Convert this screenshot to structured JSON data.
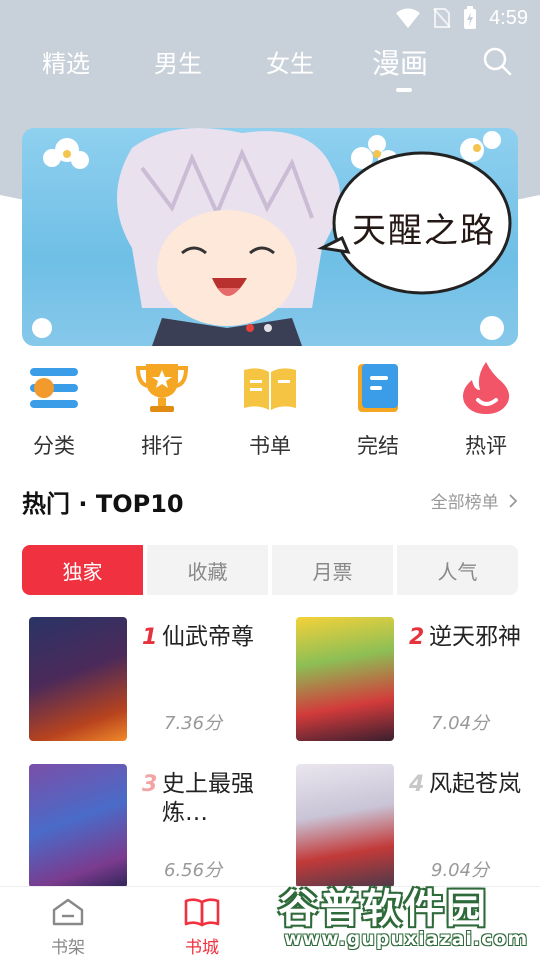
{
  "status": {
    "time": "4:59"
  },
  "nav": {
    "tabs": [
      "精选",
      "男生",
      "女生",
      "漫画"
    ],
    "active": "漫画"
  },
  "banner": {
    "title": "天醒之路"
  },
  "categories": [
    {
      "label": "分类",
      "icon": "category-icon"
    },
    {
      "label": "排行",
      "icon": "trophy-icon"
    },
    {
      "label": "书单",
      "icon": "book-list-icon"
    },
    {
      "label": "完结",
      "icon": "finished-book-icon"
    },
    {
      "label": "热评",
      "icon": "flame-icon"
    }
  ],
  "section": {
    "title": "热门 · TOP10",
    "more": "全部榜单"
  },
  "subtabs": [
    "独家",
    "收藏",
    "月票",
    "人气"
  ],
  "books": [
    {
      "rank": "1",
      "name": "仙武帝尊",
      "score": "7.36分"
    },
    {
      "rank": "2",
      "name": "逆天邪神",
      "score": "7.04分"
    },
    {
      "rank": "3",
      "name": "史上最强炼…",
      "score": "6.56分"
    },
    {
      "rank": "4",
      "name": "风起苍岚",
      "score": "9.04分"
    }
  ],
  "bottom_nav": [
    {
      "label": "书架"
    },
    {
      "label": "书城"
    }
  ],
  "watermark": {
    "cn": "谷普软件园",
    "url": "www.gupuxiazai.com"
  },
  "colors": {
    "accent": "#f0313f",
    "rank_red": "#e5323c",
    "rank_gray": "#c8c8c8"
  }
}
